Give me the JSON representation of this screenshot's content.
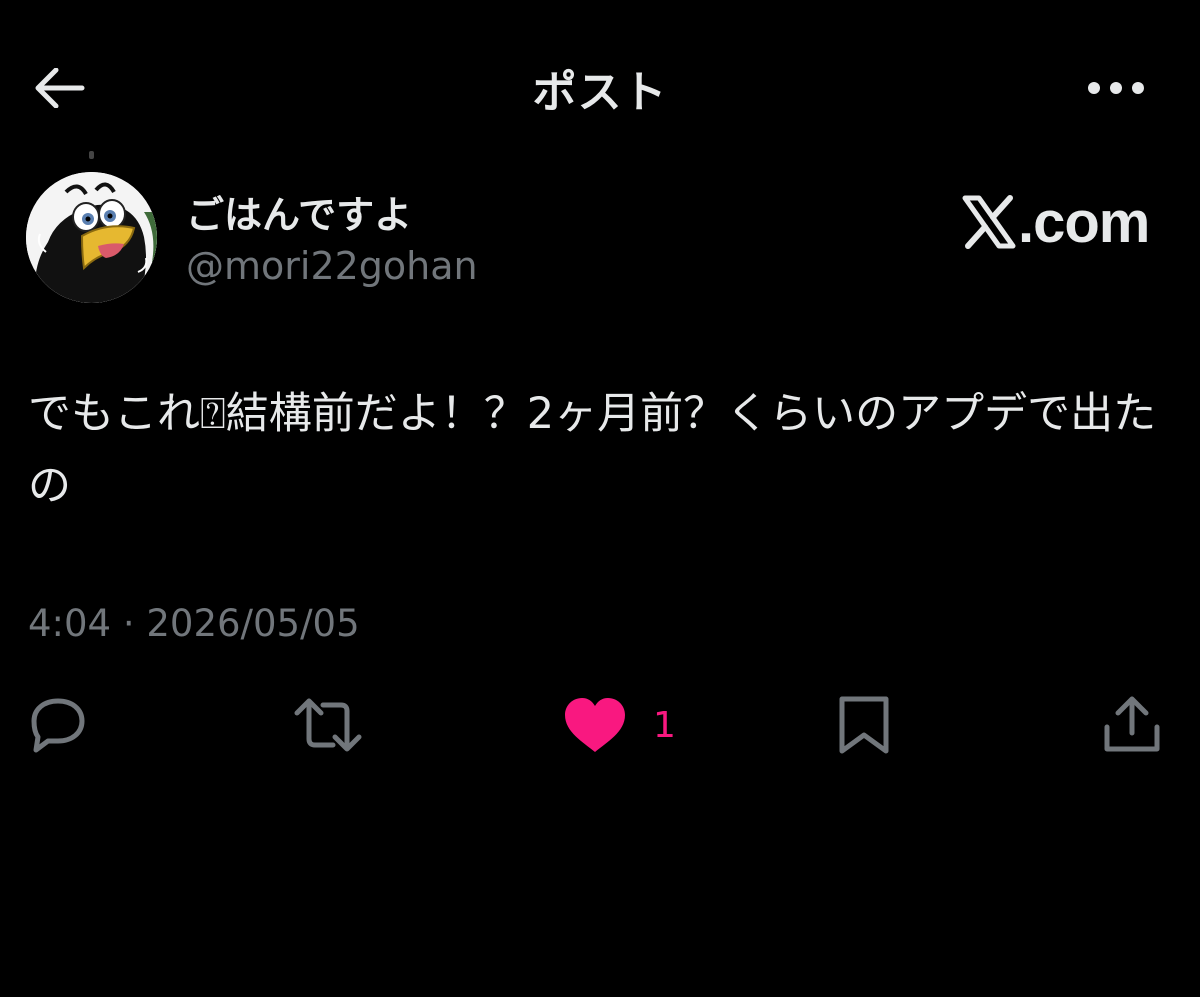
{
  "header": {
    "title": "ポスト",
    "back_icon": "arrow-left-icon",
    "more_icon": "more-horizontal-icon"
  },
  "author": {
    "name": "ごはんですよ",
    "handle": "@mori22gohan",
    "avatar_icon": "avatar-black-bird-illustration"
  },
  "brand": {
    "logo_text": ".com",
    "logo_icon": "x-logo-icon"
  },
  "post": {
    "text": "でもこれ⍰結構前だよ！？2ヶ月前？くらいのアプデで出たの",
    "timestamp": "4:04 · 2026/05/05"
  },
  "actions": {
    "reply_icon": "reply-bubble-icon",
    "repost_icon": "repost-icon",
    "like_icon": "heart-filled-icon",
    "like_count": "1",
    "bookmark_icon": "bookmark-icon",
    "share_icon": "share-upload-icon"
  },
  "colors": {
    "background": "#000000",
    "primary_text": "#e7e9ea",
    "secondary_text": "#71767b",
    "like_accent": "#f91880"
  }
}
